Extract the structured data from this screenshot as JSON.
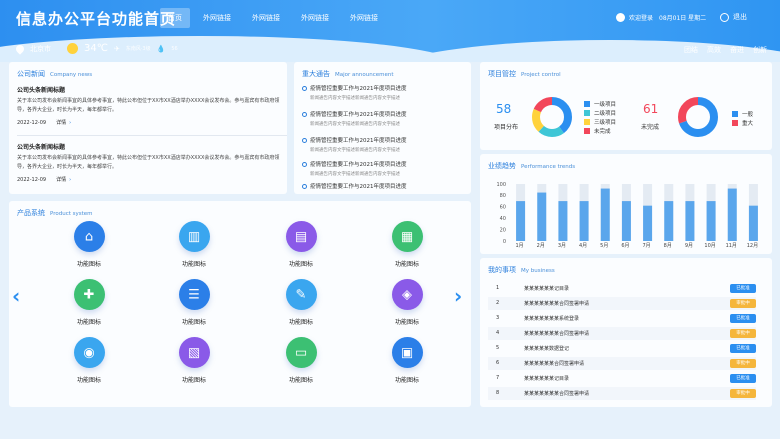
{
  "header": {
    "title": "信息办公平台功能首页",
    "nav": [
      "首页",
      "外网链接",
      "外网链接",
      "外网链接",
      "外网链接"
    ],
    "user_text": "欢迎登录　08月01日 星期二",
    "logout": "退出"
  },
  "weather": {
    "city": "北京市",
    "temp": "34℃",
    "wind": "东南风·3级",
    "extra": "56"
  },
  "toolbar": [
    "团结",
    "高效",
    "奋进",
    "创新"
  ],
  "news": {
    "title": "公司新闻",
    "title_en": "Company news",
    "items": [
      {
        "title": "公司头条新闻标题",
        "desc": "关于本公司发布会新闻事宜的具体参考事宜，特此公布但位于XX市XX酒店举办XXXX会议发布会。参与嘉宾有市政府领导，各界大企业，时长为半天，每年都举行。",
        "date": "2022-12-09",
        "more": "详情"
      },
      {
        "title": "公司头条新闻标题",
        "desc": "关于本公司发布会新闻事宜的具体参考事宜，特此公布但位于XX市XX酒店举办XXXX会议发布会。参与嘉宾有市政府领导，各界大企业，时长为半天，每年都举行。",
        "date": "2022-12-09",
        "more": "详情"
      }
    ]
  },
  "announce": {
    "title": "重大通告",
    "title_en": "Major announcement",
    "items": [
      {
        "t": "疫情管控重要工作与2021年度项目进度",
        "d": "新闻通告内容文字描述新闻通告内容文字描述"
      },
      {
        "t": "疫情管控重要工作与2021年度项目进度",
        "d": "新闻通告内容文字描述新闻通告内容文字描述"
      },
      {
        "t": "疫情管控重要工作与2021年度项目进度",
        "d": "新闻通告内容文字描述新闻通告内容文字描述"
      },
      {
        "t": "疫情管控重要工作与2021年度项目进度",
        "d": "新闻通告内容文字描述新闻通告内容文字描述"
      },
      {
        "t": "疫情管控重要工作与2021年度项目进度",
        "d": "新闻通告内容文字描述新闻通告内容文字描述"
      }
    ]
  },
  "product": {
    "title": "产品系统",
    "title_en": "Product system",
    "items": [
      {
        "label": "功能图标",
        "icon": "home-icon",
        "color": "#2b7fe8"
      },
      {
        "label": "功能图标",
        "icon": "building-icon",
        "color": "#3aa6ef"
      },
      {
        "label": "功能图标",
        "icon": "document-icon",
        "color": "#8a5ae8"
      },
      {
        "label": "功能图标",
        "icon": "chart-icon",
        "color": "#3cc073"
      },
      {
        "label": "功能图标",
        "icon": "tools-icon",
        "color": "#3cc073"
      },
      {
        "label": "功能图标",
        "icon": "server-icon",
        "color": "#2b7fe8"
      },
      {
        "label": "功能图标",
        "icon": "edit-icon",
        "color": "#3aa6ef"
      },
      {
        "label": "功能图标",
        "icon": "shield-icon",
        "color": "#8a5ae8"
      },
      {
        "label": "功能图标",
        "icon": "database-icon",
        "color": "#3aa6ef"
      },
      {
        "label": "功能图标",
        "icon": "report-icon",
        "color": "#8a5ae8"
      },
      {
        "label": "功能图标",
        "icon": "card-icon",
        "color": "#3cc073"
      },
      {
        "label": "功能图标",
        "icon": "calculator-icon",
        "color": "#2b7fe8"
      }
    ]
  },
  "project": {
    "title": "项目管控",
    "title_en": "Project control",
    "dist_value": "58",
    "dist_label": "项目分布",
    "done_value": "61",
    "done_label": "未完成",
    "legend1": [
      {
        "name": "一级项目",
        "color": "#2b8ff0"
      },
      {
        "name": "二级项目",
        "color": "#3ec6d6"
      },
      {
        "name": "三级项目",
        "color": "#ffd23c"
      },
      {
        "name": "未完成",
        "color": "#f2475b"
      }
    ],
    "legend2": [
      {
        "name": "一般",
        "color": "#2b8ff0"
      },
      {
        "name": "重大",
        "color": "#f2475b"
      }
    ]
  },
  "trend": {
    "title": "业绩趋势",
    "title_en": "Performance trends"
  },
  "chart_data": {
    "type": "bar",
    "categories": [
      "1月",
      "2月",
      "3月",
      "4月",
      "5月",
      "6月",
      "7月",
      "8月",
      "9月",
      "10月",
      "11月",
      "12月"
    ],
    "values": [
      70,
      85,
      70,
      70,
      92,
      70,
      62,
      70,
      70,
      70,
      92,
      62
    ],
    "background_values": [
      100,
      100,
      100,
      100,
      100,
      100,
      100,
      100,
      100,
      100,
      100,
      100
    ],
    "yticks": [
      "100",
      "80",
      "60",
      "40",
      "20",
      "0"
    ],
    "ylim": [
      0,
      100
    ]
  },
  "business": {
    "title": "我的事项",
    "title_en": "My business",
    "rows": [
      {
        "n": "1",
        "text": "某某某某某某记目录",
        "badge": "已批准",
        "color": "#2b8ff0"
      },
      {
        "n": "2",
        "text": "某某某某某某某合同签署申请",
        "badge": "审批中",
        "color": "#f5b63c"
      },
      {
        "n": "3",
        "text": "某某某某某某某系统登录",
        "badge": "已批准",
        "color": "#2b8ff0"
      },
      {
        "n": "4",
        "text": "某某某某某某某合同签署申请",
        "badge": "审批中",
        "color": "#f5b63c"
      },
      {
        "n": "5",
        "text": "某某某某某数据登记",
        "badge": "已批准",
        "color": "#2b8ff0"
      },
      {
        "n": "6",
        "text": "某某某某某某合同签署申请",
        "badge": "审批中",
        "color": "#f5b63c"
      },
      {
        "n": "7",
        "text": "某某某某某某记目录",
        "badge": "已批准",
        "color": "#2b8ff0"
      },
      {
        "n": "8",
        "text": "某某某某某某某合同签署申请",
        "badge": "审批中",
        "color": "#f5b63c"
      }
    ]
  }
}
